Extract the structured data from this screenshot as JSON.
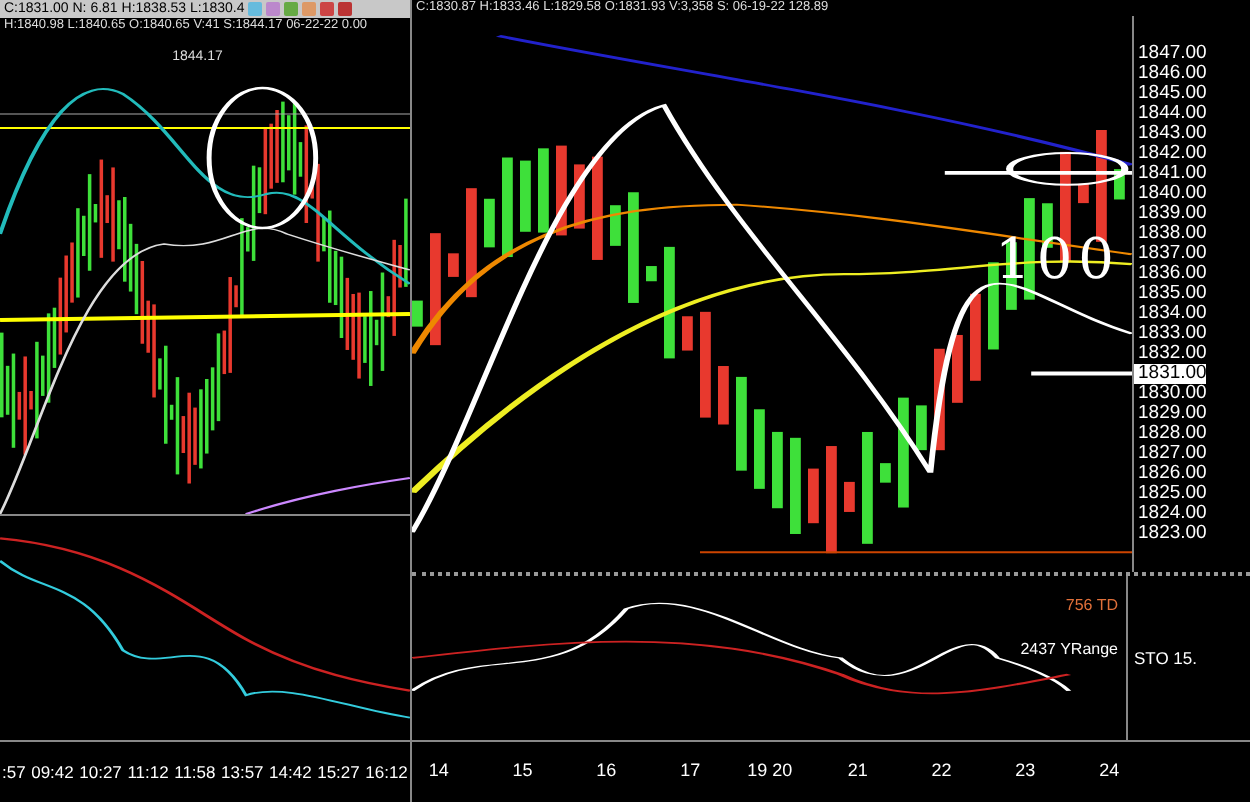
{
  "left_chart": {
    "quote_line": "C:1831.00 N: 6.81 H:1838.53 L:1830.4",
    "detail_line": "H:1840.98 L:1840.65 O:1840.65 V:41 S:1844.17 06-22-22 0.00",
    "price_tag": "1844.17",
    "time_labels": [
      ":57",
      "09:42",
      "10:27",
      "11:12",
      "11:58",
      "13:57",
      "14:42",
      "15:27",
      "16:12"
    ]
  },
  "right_chart": {
    "detail_line": "C:1830.87 H:1833.46 L:1829.58 O:1831.93 V:3,358 S: 06-19-22 128.89",
    "annotation": "100",
    "price_labels": [
      {
        "text": "1847.00",
        "selected": false
      },
      {
        "text": "1846.00",
        "selected": false
      },
      {
        "text": "1845.00",
        "selected": false
      },
      {
        "text": "1844.00",
        "selected": false
      },
      {
        "text": "1843.00",
        "selected": false
      },
      {
        "text": "1842.00",
        "selected": false
      },
      {
        "text": "1841.00",
        "selected": false
      },
      {
        "text": "1840.00",
        "selected": false
      },
      {
        "text": "1839.00",
        "selected": false
      },
      {
        "text": "1838.00",
        "selected": false
      },
      {
        "text": "1837.00",
        "selected": false
      },
      {
        "text": "1836.00",
        "selected": false
      },
      {
        "text": "1835.00",
        "selected": false
      },
      {
        "text": "1834.00",
        "selected": false
      },
      {
        "text": "1833.00",
        "selected": false
      },
      {
        "text": "1832.00",
        "selected": false
      },
      {
        "text": "1831.00",
        "selected": true
      },
      {
        "text": "1830.00",
        "selected": false
      },
      {
        "text": "1829.00",
        "selected": false
      },
      {
        "text": "1828.00",
        "selected": false
      },
      {
        "text": "1827.00",
        "selected": false
      },
      {
        "text": "1826.00",
        "selected": false
      },
      {
        "text": "1825.00",
        "selected": false
      },
      {
        "text": "1824.00",
        "selected": false
      },
      {
        "text": "1823.00",
        "selected": false
      }
    ],
    "indicators": [
      {
        "text": "756 TD",
        "color": "#e0703a"
      },
      {
        "text": "2437 YRange",
        "color": "#ffffff"
      }
    ],
    "sto_label": "STO  15.",
    "date_labels": [
      "14",
      "15",
      "16",
      "17",
      "19",
      "20",
      "21",
      "22",
      "23",
      "24"
    ]
  }
}
